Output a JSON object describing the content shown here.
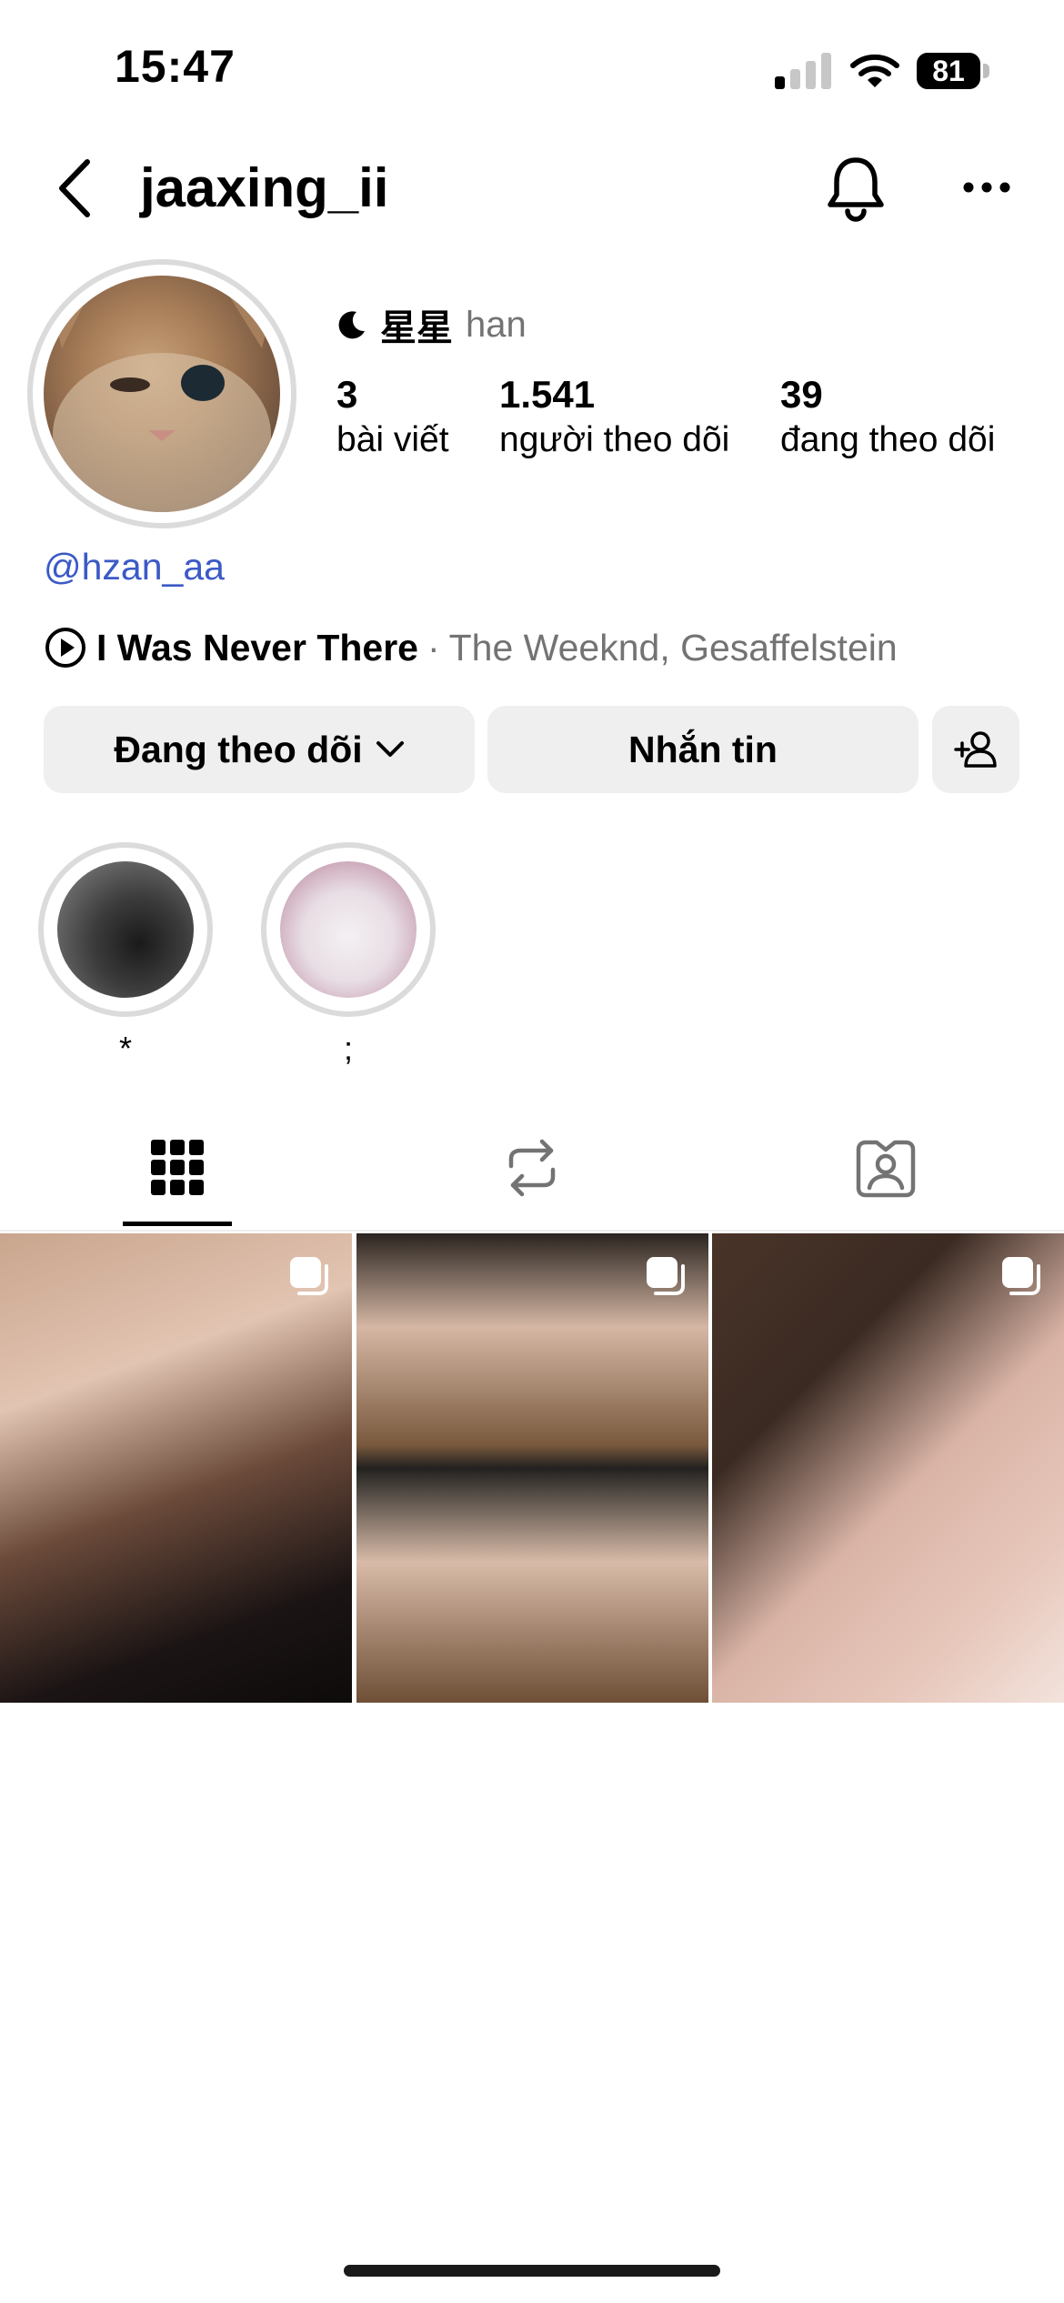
{
  "status_bar": {
    "time": "15:47",
    "battery": "81"
  },
  "header": {
    "username": "jaaxing_ii"
  },
  "profile": {
    "name_main": "星星",
    "name_sub": "han",
    "stats": [
      {
        "value": "3",
        "label": "bài viết"
      },
      {
        "value": "1.541",
        "label": "người theo dõi"
      },
      {
        "value": "39",
        "label": "đang theo dõi"
      }
    ],
    "handle": "@hzan_aa",
    "music": {
      "song": "I Was Never There",
      "separator": "·",
      "artist": "The Weeknd, Gesaffelstein"
    }
  },
  "buttons": {
    "following": "Đang theo dõi",
    "message": "Nhắn tin"
  },
  "highlights": [
    {
      "label": "*"
    },
    {
      "label": ";"
    }
  ],
  "tabs": [
    "grid",
    "reposts",
    "tagged"
  ],
  "colors": {
    "link": "#3b5ac7",
    "button_bg": "#efefef",
    "secondary_text": "#737373"
  }
}
